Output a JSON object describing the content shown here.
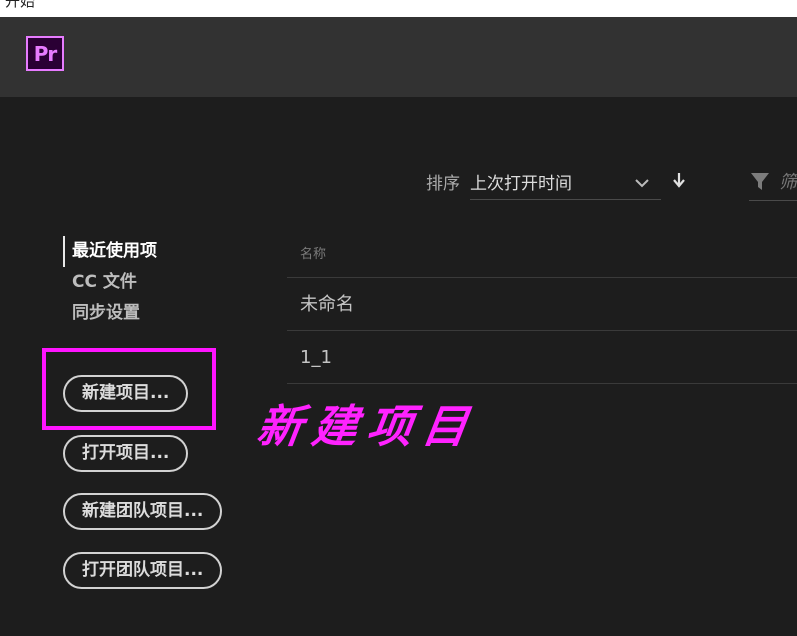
{
  "window": {
    "title": "开始"
  },
  "header": {
    "logo_text": "Pr",
    "brand_color": "#e77bff"
  },
  "sort": {
    "label": "排序",
    "selected": "上次打开时间"
  },
  "filter": {
    "placeholder": "筛"
  },
  "nav": [
    {
      "label": "最近使用项",
      "active": true
    },
    {
      "label": "CC 文件",
      "active": false
    },
    {
      "label": "同步设置",
      "active": false
    }
  ],
  "actions": {
    "new_project": "新建项目...",
    "open_project": "打开项目...",
    "new_team_project": "新建团队项目...",
    "open_team_project": "打开团队项目..."
  },
  "annotation": {
    "text": "新建项目",
    "color": "#ff14ff"
  },
  "list": {
    "column_name": "名称",
    "items": [
      "未命名",
      "1_1"
    ]
  }
}
